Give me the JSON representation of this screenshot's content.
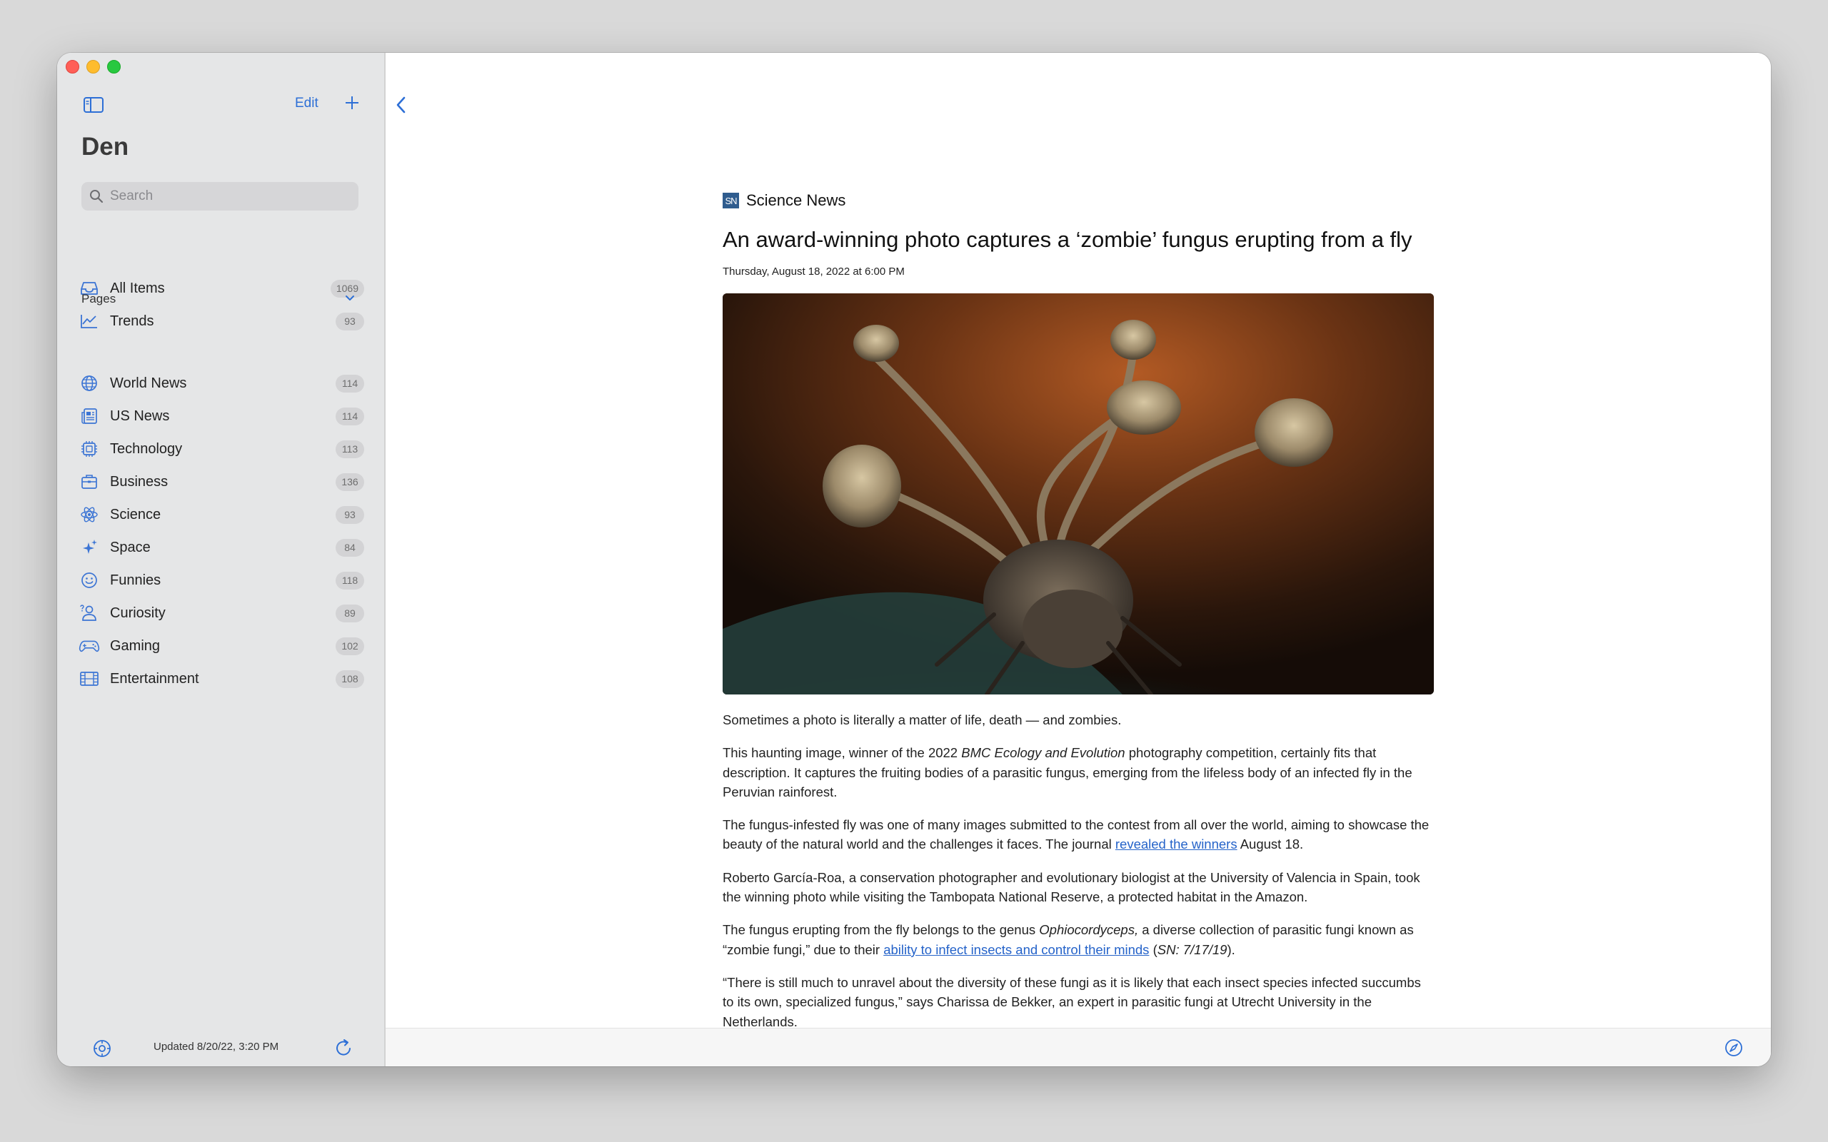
{
  "sidebar": {
    "title": "Den",
    "edit_label": "Edit",
    "search_placeholder": "Search",
    "top_items": [
      {
        "label": "All Items",
        "count": "1069",
        "icon": "tray-icon"
      },
      {
        "label": "Trends",
        "count": "93",
        "icon": "trend-chart-icon"
      }
    ],
    "section_label": "Pages",
    "pages": [
      {
        "label": "World News",
        "count": "114",
        "icon": "globe-icon"
      },
      {
        "label": "US News",
        "count": "114",
        "icon": "newspaper-icon"
      },
      {
        "label": "Technology",
        "count": "113",
        "icon": "cpu-icon"
      },
      {
        "label": "Business",
        "count": "136",
        "icon": "briefcase-icon"
      },
      {
        "label": "Science",
        "count": "93",
        "icon": "atom-icon"
      },
      {
        "label": "Space",
        "count": "84",
        "icon": "sparkles-icon"
      },
      {
        "label": "Funnies",
        "count": "118",
        "icon": "smiley-icon"
      },
      {
        "label": "Curiosity",
        "count": "89",
        "icon": "person-question-icon"
      },
      {
        "label": "Gaming",
        "count": "102",
        "icon": "gamepad-icon"
      },
      {
        "label": "Entertainment",
        "count": "108",
        "icon": "film-icon"
      }
    ],
    "updated": "Updated 8/20/22, 3:20 PM"
  },
  "article": {
    "source_logo": "SN",
    "source": "Science News",
    "headline": "An award-winning photo captures a ‘zombie’ fungus erupting from a fly",
    "date": "Thursday, August 18, 2022 at 6:00 PM",
    "p1": "Sometimes a photo is literally a matter of life, death — and zombies.",
    "p2_a": "This haunting image, winner of the 2022 ",
    "p2_em": "BMC Ecology and Evolution",
    "p2_b": " photography competition, certainly fits that description. It captures the fruiting bodies of a parasitic fungus, emerging from the lifeless body of an infected fly in the Peruvian rainforest.",
    "p3_a": "The fungus-infested fly was one of many images submitted to the contest from all over the world, aiming to showcase the beauty of the natural world and the challenges it faces. The journal ",
    "p3_link": "revealed the winners",
    "p3_b": " August 18.",
    "p4": "Roberto García-Roa, a conservation photographer and evolutionary biologist at the University of Valencia in Spain, took the winning photo while visiting the Tambopata National Reserve, a protected habitat in the Amazon.",
    "p5_a": "The fungus erupting from the fly belongs to the genus ",
    "p5_em": "Ophiocordyceps,",
    "p5_b": " a diverse collection of parasitic fungi known as “zombie fungi,” due to their ",
    "p5_link": "ability to infect insects and control their minds",
    "p5_c": " (",
    "p5_em2": "SN: 7/17/19",
    "p5_d": ").",
    "p6": "“There is still much to unravel about the diversity of these fungi as it is likely that each insect species infected succumbs to its own, specialized fungus,” says Charissa de Bekker, an expert in parasitic fungi at Utrecht University in the Netherlands."
  },
  "colors": {
    "accent": "#2d6fd6",
    "sidebar_bg": "#e5e6e7",
    "link": "#2563c9"
  }
}
